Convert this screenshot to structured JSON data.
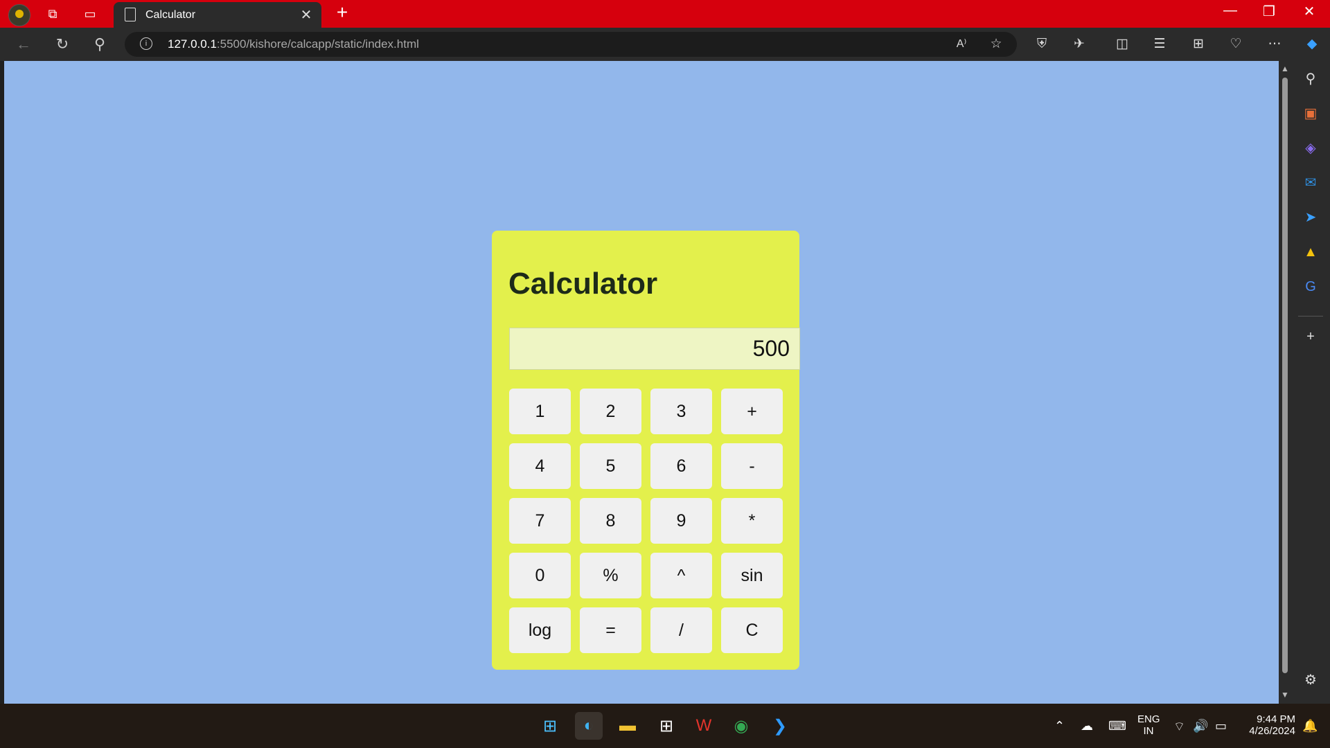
{
  "browser": {
    "tab_title": "Calculator",
    "tab_close": "✕",
    "new_tab": "+",
    "url_host": "127.0.0.1",
    "url_path": ":5500/kishore/calcapp/static/index.html",
    "window_controls": {
      "minimize": "—",
      "restore": "❐",
      "close": "✕"
    }
  },
  "page": {
    "title": "Calculator",
    "display_value": "500",
    "keys": [
      "1",
      "2",
      "3",
      "+",
      "4",
      "5",
      "6",
      "-",
      "7",
      "8",
      "9",
      "*",
      "0",
      "%",
      "^",
      "sin",
      "log",
      "=",
      "/",
      "C"
    ],
    "colors": {
      "background": "#92b7eb",
      "panel": "#e3f04c",
      "display": "#eef5c4",
      "key": "#f0f0f0"
    }
  },
  "taskbar": {
    "language_line1": "ENG",
    "language_line2": "IN",
    "time": "9:44 PM",
    "date": "4/26/2024"
  }
}
